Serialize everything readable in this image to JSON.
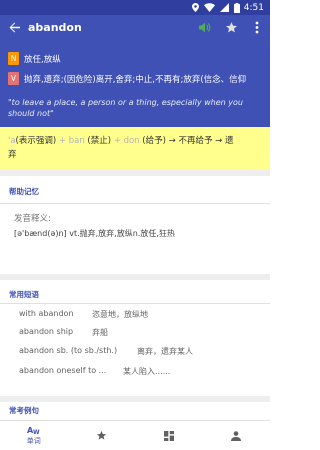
{
  "status_bar": {
    "time": "4:51"
  },
  "app_bar": {
    "word": "abandon"
  },
  "definitions": [
    {
      "pos": "N",
      "text": "放任,放纵"
    },
    {
      "pos": "V",
      "text": "抛弃,遗弃;(因危险)离开,舍弃;中止,不再有;放弃(信念、信仰"
    }
  ],
  "example": "\"to leave a place, a person or a thing, especially when you should not\"",
  "etymology": {
    "parts": [
      {
        "text": "'a",
        "light": true
      },
      {
        "text": "(表示强调)",
        "light": false
      },
      {
        "text": " + ban ",
        "light": true
      },
      {
        "text": "(禁止)",
        "light": false
      },
      {
        "text": " + don ",
        "light": true
      },
      {
        "text": "(给予) → 不再给予 → 遗",
        "light": false
      }
    ],
    "line2": "弃"
  },
  "mnemonic": {
    "title": "帮助记忆",
    "label": "发音释义:",
    "text": "[ə'bænd(ə)n] vt.抛弃,放弃,放纵n.放任,狂热"
  },
  "phrases": {
    "title": "常用短语",
    "items": [
      {
        "en": "with abandon",
        "zh": "恣意地，放纵地"
      },
      {
        "en": "abandon ship",
        "zh": "弃船"
      },
      {
        "en": "abandon sb. (to sb./sth.)",
        "zh": "离弃，遗弃某人"
      },
      {
        "en": "abandon oneself to ...",
        "zh": "某人陷入......"
      }
    ]
  },
  "examples_section": {
    "title": "常考例句"
  },
  "bottom_nav": {
    "items": [
      {
        "icon": "word-icon",
        "label": "单词"
      },
      {
        "icon": "star-icon",
        "label": ""
      },
      {
        "icon": "dashboard-icon",
        "label": ""
      },
      {
        "icon": "person-icon",
        "label": ""
      }
    ]
  },
  "colors": {
    "primary": "#3f51b5",
    "primary_dark": "#303f9f",
    "highlight": "#ffff8d",
    "noun_badge": "#ff9800",
    "verb_badge": "#e57373",
    "speaker": "#4caf50"
  }
}
